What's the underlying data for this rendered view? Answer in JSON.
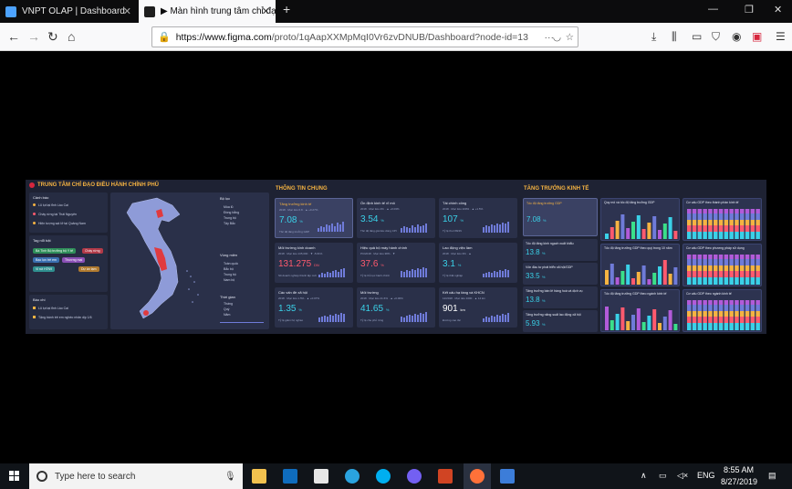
{
  "browser": {
    "tabs": [
      {
        "label": "VNPT OLAP | Dashboard",
        "active": false
      },
      {
        "label": "▶ Màn hình trung tâm chỉ đạo",
        "active": true
      }
    ],
    "new_tab": "+",
    "url_domain": "https://www.figma.com",
    "url_path": "/proto/1qAapXXMpMqI0Vr6zvDNUB/Dashboard?node-id=13"
  },
  "dashboard": {
    "left_title": "TRUNG TÂM CHỈ ĐẠO ĐIỀU HÀNH CHÍNH PHỦ",
    "mid_title": "THÔNG TIN CHUNG",
    "right_title": "TĂNG TRƯỞNG KINH TẾ",
    "left_panels": {
      "alerts_title": "Cảnh báo",
      "alerts": [
        "Lũ lụt tại tỉnh Lào Cai",
        "Cháy rừng tại Thái Nguyên",
        "Hiện tượng sạt lở tại Quảng Nam"
      ],
      "tags_title": "Tag nổi bật",
      "tags": [
        "Bà Tình Bộ trưởng bộ Y tế",
        "Cháy rừng",
        "Bạo lực trẻ em",
        "Thương mại",
        "Vi rút H7N9",
        "Dự án tạm"
      ],
      "news_title": "Báo chí",
      "news": [
        "Lũ lụt tại tỉnh Lào Cai",
        "Tặng bánh trẻ em nghèo nhân dịp 1/6"
      ],
      "filter_title": "Bộ lọc",
      "filter_items": [
        "Mùa lũ",
        "Đồng bằng",
        "Trung bộ",
        "Tây Bắc"
      ],
      "area_title": "Vùng miền",
      "area_items": [
        "Toàn quốc",
        "Bắc bộ",
        "Trung bộ",
        "Nam bộ"
      ],
      "time_title": "Thời gian",
      "time_items": [
        "Tháng",
        "Quý",
        "Năm"
      ]
    },
    "kpis": [
      {
        "title": "Tăng trưởng kinh tế",
        "sub": "2018 · Mục tiêu 6.8 · ▲ +0.27%",
        "value": "7.08",
        "unit": "%",
        "note": "Tốc độ tăng trưởng GDP",
        "highlight": true,
        "color": "cyan"
      },
      {
        "title": "Ổn định kinh tế vĩ mô",
        "sub": "2018 · Mục tiêu 4% · ▲ +0.03%",
        "value": "3.54",
        "unit": "%",
        "note": "Tốc độ tăng giá tiêu dùng CPI",
        "highlight": false,
        "color": "cyan"
      },
      {
        "title": "Tài chính công",
        "sub": "2018 · Mục tiêu 100% · ▲ +1.5%",
        "value": "107",
        "unit": "%",
        "note": "Tỷ lệ thu NSNN",
        "highlight": false,
        "color": "cyan"
      },
      {
        "title": "Môi trường kinh doanh",
        "sub": "2018 · Mục tiêu 135,000 · ▼ -5.61%",
        "value": "131.275",
        "unit": "DN",
        "note": "Số doanh nghiệp thành lập mới",
        "highlight": false,
        "color": "red"
      },
      {
        "title": "Hiệu quả bộ máy hành chính",
        "sub": "PCI2018 · Mục tiêu 38% · ▼",
        "value": "37.6",
        "unit": "%",
        "note": "Tỷ lệ thủ tục hành chính",
        "highlight": false,
        "color": "red"
      },
      {
        "title": "Lao động việc làm",
        "sub": "2018 · Mục tiêu 3% · ▲",
        "value": "3.1",
        "unit": "%",
        "note": "Tỷ lệ thất nghiệp",
        "highlight": false,
        "color": "cyan"
      },
      {
        "title": "Các vấn đề xã hội",
        "sub": "2018 · Mục tiêu 1.5% · ▲ +0.07%",
        "value": "1.35",
        "unit": "%",
        "note": "Tỷ lệ giảm hộ nghèo",
        "highlight": false,
        "color": "cyan"
      },
      {
        "title": "Môi trường",
        "sub": "2018 · Mục tiêu 41.6% · ▲ +0.06%",
        "value": "41.65",
        "unit": "%",
        "note": "Tỷ lệ che phủ rừng",
        "highlight": false,
        "color": "cyan"
      },
      {
        "title": "Kết cấu hạ tầng và KHCN",
        "sub": "12/2018 · Mục tiêu 1000 · ▲ 14 km",
        "value": "901",
        "unit": "km",
        "note": "Đường cao tốc",
        "highlight": false,
        "color": "white"
      }
    ],
    "growth_minis": [
      {
        "title": "Tốc độ tăng trưởng GDP",
        "value": "7.08",
        "unit": "%"
      },
      {
        "title": "Tốc độ tăng kinh ngạch xuất khẩu",
        "value": "13.8",
        "unit": "%"
      },
      {
        "title": "Vốn đầu tư phát triển xã hội/GDP",
        "value": "33.5",
        "unit": "%"
      },
      {
        "title": "Tăng trưởng bán lẻ hàng hoá và dịch vụ",
        "value": "13.8",
        "unit": "%"
      },
      {
        "title": "Tăng trưởng năng suất lao động xã hội",
        "value": "5.93",
        "unit": "%"
      }
    ],
    "charts": [
      {
        "title": "Quy mô và tốc độ tăng trưởng GDP"
      },
      {
        "title": "Cơ cấu GDP theo thành phần kinh tế"
      },
      {
        "title": "Tốc độ tăng trưởng GDP theo quý trong 10 năm"
      },
      {
        "title": "Cơ cấu GDP theo phương pháp sử dụng"
      },
      {
        "title": "Tốc độ tăng trưởng GDP theo ngành kinh tế"
      },
      {
        "title": "Cơ cấu GDP theo ngành kinh tế"
      }
    ]
  },
  "taskbar": {
    "search_placeholder": "Type here to search",
    "lang": "ENG",
    "time": "8:55 AM",
    "date": "8/27/2019"
  },
  "colors": {
    "accent": "#f5b342",
    "cyan": "#3ad1e8",
    "red": "#ff5a6e",
    "panel": "#262c42"
  }
}
